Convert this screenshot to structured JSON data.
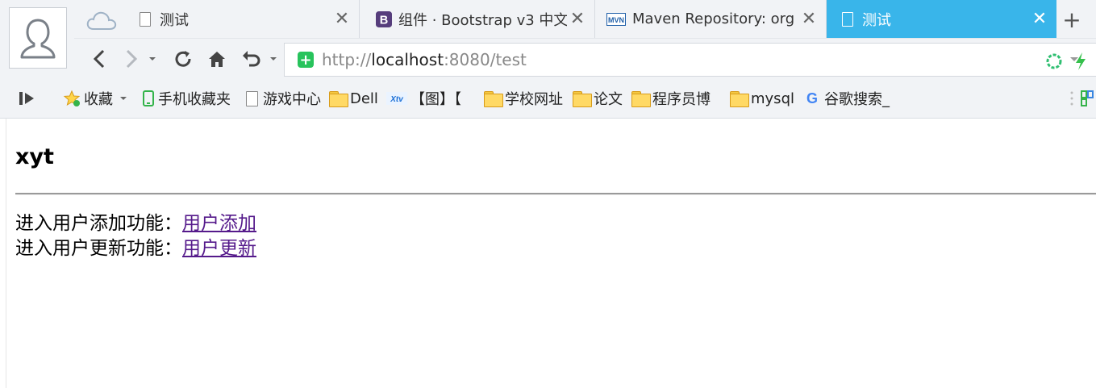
{
  "tabs": [
    {
      "title": "测试",
      "icon": "page-icon"
    },
    {
      "title": "组件 · Bootstrap v3 中文",
      "icon": "bootstrap-icon"
    },
    {
      "title": "Maven Repository: org",
      "icon": "mvn-icon"
    },
    {
      "title": "测试",
      "icon": "page-icon",
      "active": true
    }
  ],
  "tab_close_glyph": "✕",
  "new_tab_glyph": "+",
  "url": {
    "scheme": "http://",
    "host": "localhost",
    "rest": ":8080/test"
  },
  "bookmarks": [
    {
      "label": "收藏",
      "icon": "star-icon"
    },
    {
      "label": "手机收藏夹",
      "icon": "phone-icon"
    },
    {
      "label": "游戏中心",
      "icon": "page-icon"
    },
    {
      "label": "Dell",
      "icon": "folder-icon"
    },
    {
      "label": "【图】【",
      "icon": "xtv-icon"
    },
    {
      "label": "学校网址",
      "icon": "folder-icon"
    },
    {
      "label": "论文",
      "icon": "folder-icon"
    },
    {
      "label": "程序员博",
      "icon": "folder-icon"
    },
    {
      "label": "mysql",
      "icon": "folder-icon"
    },
    {
      "label": "谷歌搜索_",
      "icon": "google-icon"
    }
  ],
  "page": {
    "heading": "xyt",
    "line1_text": "进入用户添加功能：",
    "line1_link": "用户添加",
    "line2_text": "进入用户更新功能：",
    "line2_link": "用户更新"
  },
  "colors": {
    "active_tab": "#39b5ea",
    "link_visited": "#551a8b",
    "shield": "#28c35c"
  }
}
